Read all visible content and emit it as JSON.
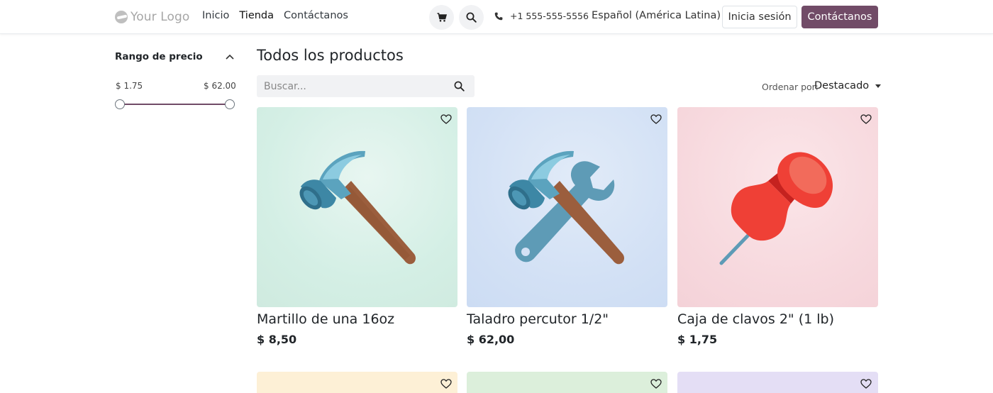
{
  "header": {
    "logo_text": "Your Logo",
    "nav": [
      {
        "label": "Inicio",
        "active": false
      },
      {
        "label": "Tienda",
        "active": true
      },
      {
        "label": "Contáctanos",
        "active": false
      }
    ],
    "phone": "+1 555-555-5556",
    "language": "Español (América Latina)",
    "login_label": "Inicia sesión",
    "contact_label": "Contáctanos",
    "icons": [
      "cart-icon",
      "search-icon",
      "phone-icon",
      "chevron-down-icon"
    ]
  },
  "sidebar": {
    "price_range_title": "Rango de precio",
    "price_min": "$ 1.75",
    "price_max": "$ 62.00",
    "slider_accent": "#714b67"
  },
  "main": {
    "title": "Todos los productos",
    "search_placeholder": "Buscar...",
    "sort_label": "Ordenar por:",
    "sort_value": "Destacado",
    "products": [
      {
        "name": "Martillo de una 16oz",
        "price": "$ 8,50",
        "image_icon": "hammer-icon"
      },
      {
        "name": "Taladro percutor 1/2\"",
        "price": "$ 62,00",
        "image_icon": "hammer-and-wrench-icon"
      },
      {
        "name": "Caja de clavos 2\" (1 lb)",
        "price": "$ 1,75",
        "image_icon": "pushpin-icon"
      }
    ]
  },
  "colors": {
    "brand": "#714b67"
  }
}
